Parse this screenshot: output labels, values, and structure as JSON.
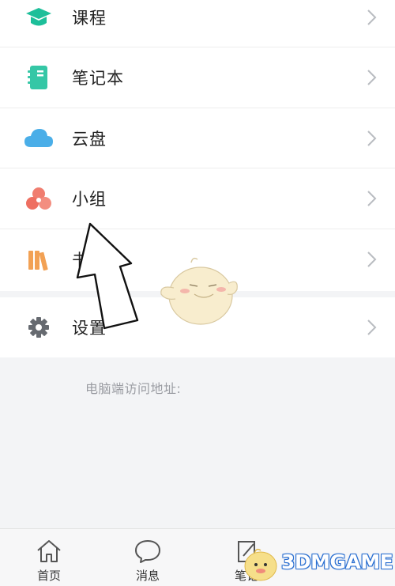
{
  "menu": {
    "items": [
      {
        "label": "课程",
        "icon": "graduation-cap-icon",
        "color": "#1dbf9a"
      },
      {
        "label": "笔记本",
        "icon": "notebook-icon",
        "color": "#35c7a6"
      },
      {
        "label": "云盘",
        "icon": "cloud-icon",
        "color": "#4aaee8"
      },
      {
        "label": "小组",
        "icon": "group-circles-icon",
        "color": "#f07d6f"
      },
      {
        "label": "书架",
        "icon": "bookshelf-icon",
        "color": "#f2a154"
      }
    ],
    "settings": {
      "label": "设置",
      "icon": "gear-icon",
      "color": "#666a70"
    }
  },
  "access_address_label": "电脑端访问地址:",
  "tabbar": {
    "tabs": [
      {
        "label": "首页",
        "icon": "home-icon"
      },
      {
        "label": "消息",
        "icon": "message-bubble-icon"
      },
      {
        "label": "笔记",
        "icon": "edit-note-icon"
      }
    ]
  },
  "watermark": {
    "text": "3DMGAME"
  }
}
